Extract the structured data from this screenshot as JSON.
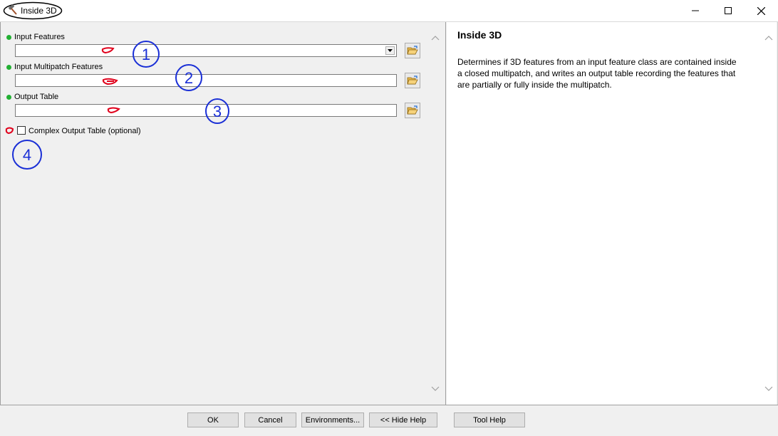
{
  "window": {
    "title": "Inside 3D",
    "icons": {
      "app": "hammer-icon",
      "minimize": "minimize-icon",
      "maximize": "maximize-icon",
      "close": "close-icon"
    }
  },
  "params": {
    "input_features": {
      "label": "Input Features",
      "value": ""
    },
    "input_multipatch": {
      "label": "Input Multipatch Features",
      "value": ""
    },
    "output_table": {
      "label": "Output Table",
      "value": ""
    },
    "complex_output": {
      "label": "Complex Output Table (optional)",
      "checked": false
    }
  },
  "help": {
    "title": "Inside 3D",
    "body": "Determines if 3D features from an input feature class are contained inside a closed multipatch, and writes an output table recording the features that are partially or fully inside the multipatch."
  },
  "buttons": {
    "ok": "OK",
    "cancel": "Cancel",
    "environments": "Environments...",
    "hide_help": "<< Hide Help",
    "tool_help": "Tool Help"
  },
  "annotations": [
    "1",
    "2",
    "3",
    "4"
  ],
  "colors": {
    "required_dot": "#22b033",
    "annotation_blue": "#1a2fd6",
    "annotation_red": "#e0001b"
  }
}
